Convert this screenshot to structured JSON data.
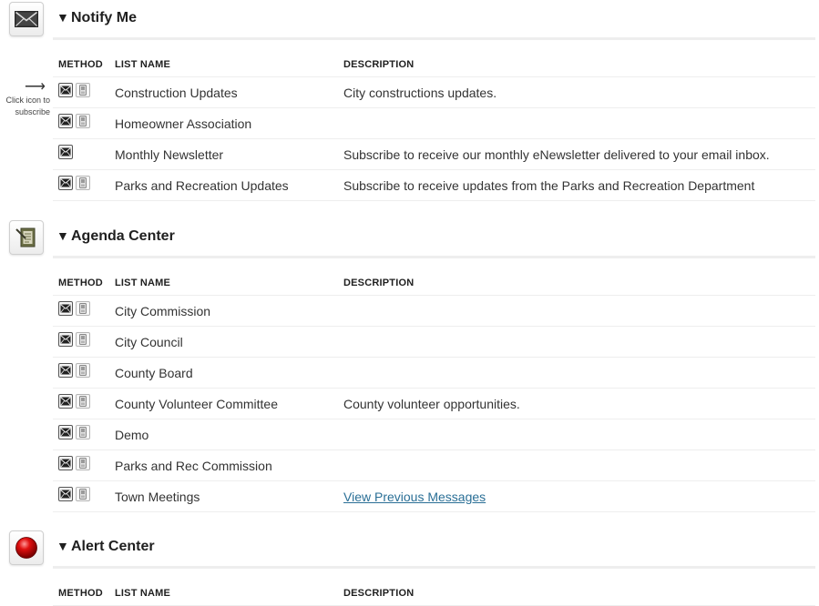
{
  "columns": {
    "method": "METHOD",
    "list_name": "LIST NAME",
    "description": "DESCRIPTION"
  },
  "hint": {
    "arrow": "⟶",
    "text": "Click icon to subscribe"
  },
  "sections": [
    {
      "title": "Notify Me",
      "icon": "envelope-icon",
      "rows": [
        {
          "name": "Construction Updates",
          "description": "City constructions updates.",
          "email": true,
          "sms": true
        },
        {
          "name": "Homeowner Association",
          "description": "",
          "email": true,
          "sms": true
        },
        {
          "name": "Monthly Newsletter",
          "description": "Subscribe to receive our monthly eNewsletter delivered to your email inbox.",
          "email": true,
          "sms": false
        },
        {
          "name": "Parks and Recreation Updates",
          "description": "Subscribe to receive updates from the Parks and Recreation Department",
          "email": true,
          "sms": true
        }
      ]
    },
    {
      "title": "Agenda Center",
      "icon": "agenda-icon",
      "rows": [
        {
          "name": "City Commission",
          "description": "",
          "email": true,
          "sms": true
        },
        {
          "name": "City Council",
          "description": "",
          "email": true,
          "sms": true
        },
        {
          "name": "County Board",
          "description": "",
          "email": true,
          "sms": true
        },
        {
          "name": "County Volunteer Committee",
          "description": "County volunteer opportunities.",
          "email": true,
          "sms": true
        },
        {
          "name": "Demo",
          "description": "",
          "email": true,
          "sms": true
        },
        {
          "name": "Parks and Rec Commission",
          "description": "",
          "email": true,
          "sms": true
        },
        {
          "name": "Town Meetings",
          "description": "View Previous Messages",
          "description_is_link": true,
          "email": true,
          "sms": true
        }
      ]
    },
    {
      "title": "Alert Center",
      "icon": "alert-icon",
      "rows": []
    }
  ]
}
